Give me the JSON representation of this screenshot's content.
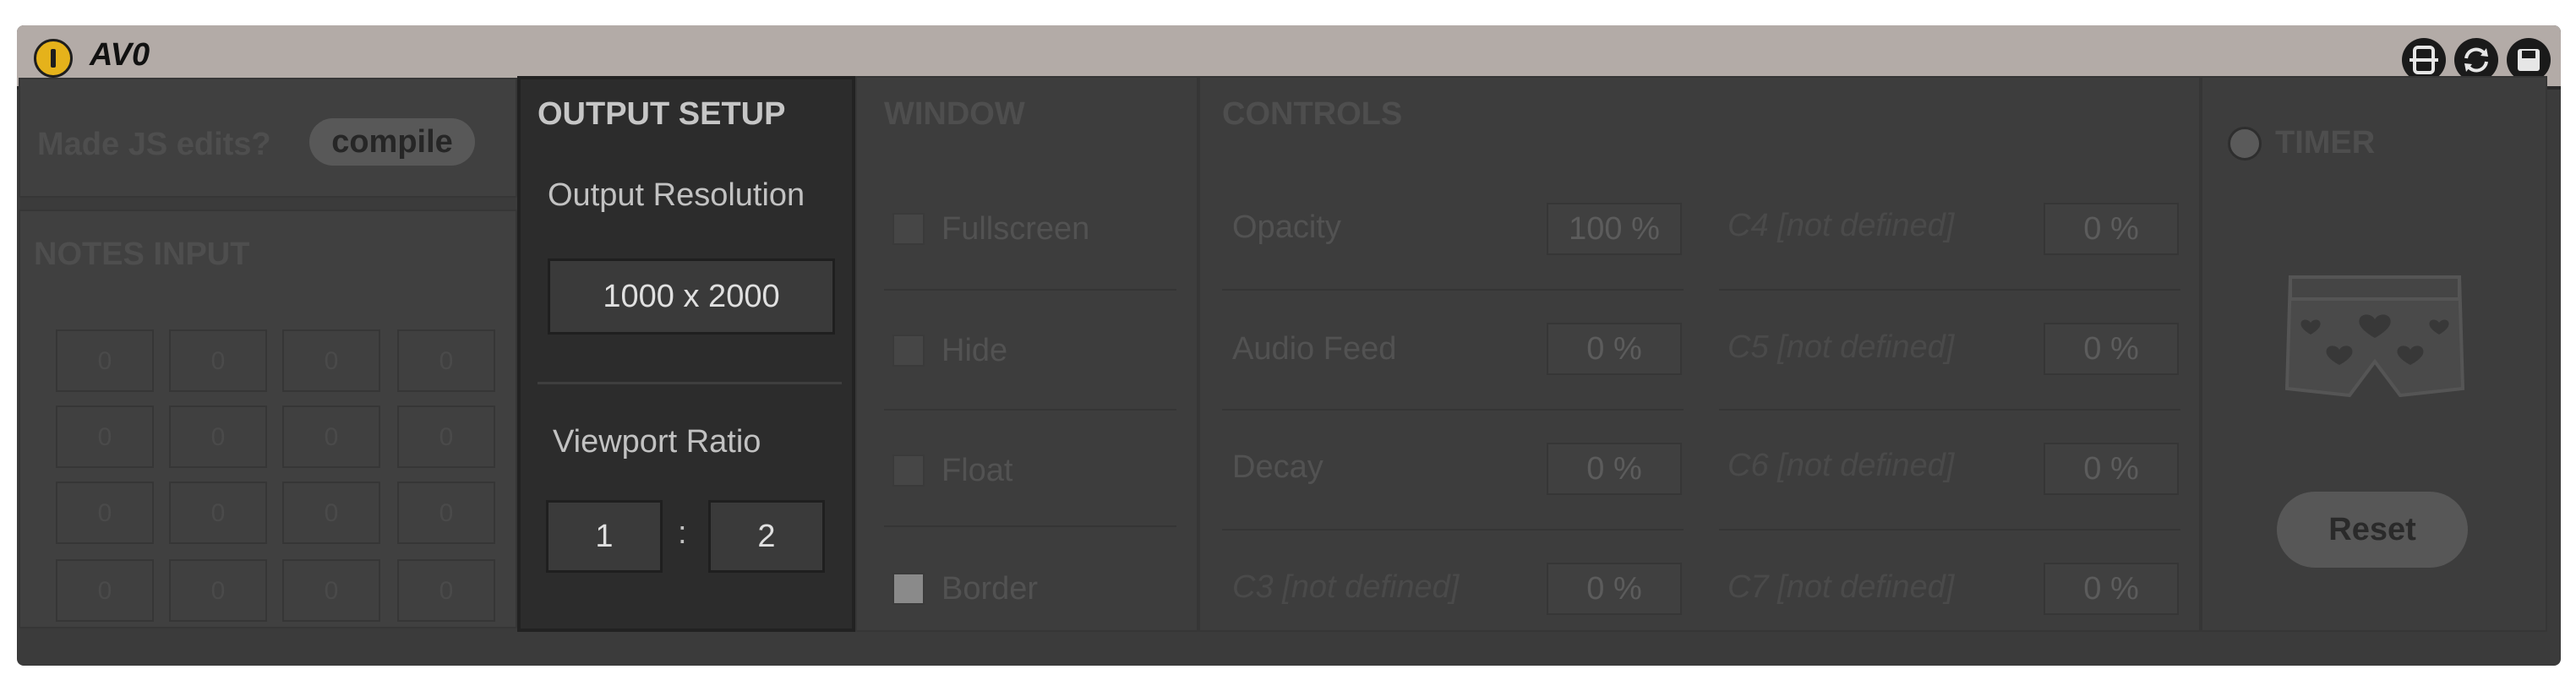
{
  "device": {
    "title": "AV0"
  },
  "title_icons": [
    "fold-icon",
    "sync-icon",
    "save-icon"
  ],
  "js": {
    "prompt": "Made JS edits?",
    "compile_label": "compile"
  },
  "notes": {
    "title": "NOTES INPUT",
    "grid": [
      [
        "0",
        "0",
        "0",
        "0"
      ],
      [
        "0",
        "0",
        "0",
        "0"
      ],
      [
        "0",
        "0",
        "0",
        "0"
      ],
      [
        "0",
        "0",
        "0",
        "0"
      ]
    ]
  },
  "output": {
    "title": "OUTPUT SETUP",
    "resolution_label": "Output Resolution",
    "resolution_value": "1000 x 2000",
    "viewport_label": "Viewport Ratio",
    "ratio_left": "1",
    "ratio_sep": ":",
    "ratio_right": "2"
  },
  "window": {
    "title": "WINDOW",
    "options": [
      {
        "label": "Fullscreen",
        "checked": false
      },
      {
        "label": "Hide",
        "checked": false
      },
      {
        "label": "Float",
        "checked": false
      },
      {
        "label": "Border",
        "checked": true
      }
    ]
  },
  "controls": {
    "title": "CONTROLS",
    "left": [
      {
        "name": "Opacity",
        "value": "100 %",
        "defined": true
      },
      {
        "name": "Audio Feed",
        "value": "0 %",
        "defined": true
      },
      {
        "name": "Decay",
        "value": "0 %",
        "defined": true
      },
      {
        "name": "C3 [not defined]",
        "value": "0 %",
        "defined": false
      }
    ],
    "right": [
      {
        "name": "C4 [not defined]",
        "value": "0 %",
        "defined": false
      },
      {
        "name": "C5 [not defined]",
        "value": "0 %",
        "defined": false
      },
      {
        "name": "C6 [not defined]",
        "value": "0 %",
        "defined": false
      },
      {
        "name": "C7 [not defined]",
        "value": "0 %",
        "defined": false
      }
    ]
  },
  "timer": {
    "label": "TIMER",
    "reset_label": "Reset",
    "image_icon": "boxer-shorts-icon"
  },
  "colors": {
    "power": "#e5b21b",
    "titlebar": "#b3aba7",
    "panel": "#3b3b3b"
  }
}
